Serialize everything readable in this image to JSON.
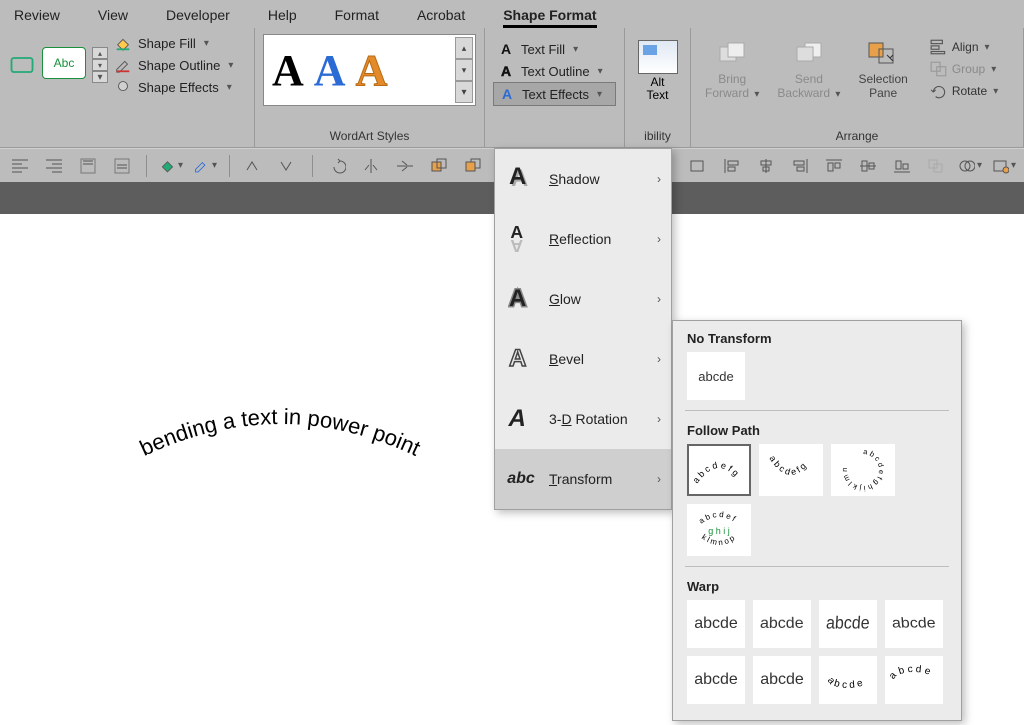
{
  "menu": {
    "items": [
      "Review",
      "View",
      "Developer",
      "Help",
      "Format",
      "Acrobat",
      "Shape Format"
    ],
    "active": "Shape Format"
  },
  "ribbon": {
    "shapes": {
      "abc": "Abc",
      "fill": "Shape Fill",
      "outline": "Shape Outline",
      "effects": "Shape Effects"
    },
    "wordart": {
      "group_label": "WordArt Styles",
      "textfill": "Text Fill",
      "textoutline": "Text Outline",
      "texteffects": "Text Effects"
    },
    "acc": {
      "alt": "Alt",
      "text": "Text",
      "group_label": "ibility"
    },
    "arrange": {
      "bring": "Bring",
      "forward": "Forward",
      "send": "Send",
      "backward": "Backward",
      "selection": "Selection",
      "pane": "Pane",
      "align": "Align",
      "group": "Group",
      "rotate": "Rotate",
      "group_label": "Arrange"
    }
  },
  "text_effects_menu": {
    "shadow": "Shadow",
    "reflection": "Reflection",
    "glow": "Glow",
    "bevel": "Bevel",
    "rotation": "3-D Rotation",
    "transform": "Transform"
  },
  "transform_flyout": {
    "no_transform": "No Transform",
    "abcde": "abcde",
    "follow_path": "Follow Path",
    "warp": "Warp"
  },
  "canvas": {
    "curved": "bending a text in power point"
  },
  "underline_chars": {
    "shadow": "S",
    "reflection": "R",
    "glow": "G",
    "bevel": "B",
    "rotation": "D",
    "transform": "T"
  }
}
